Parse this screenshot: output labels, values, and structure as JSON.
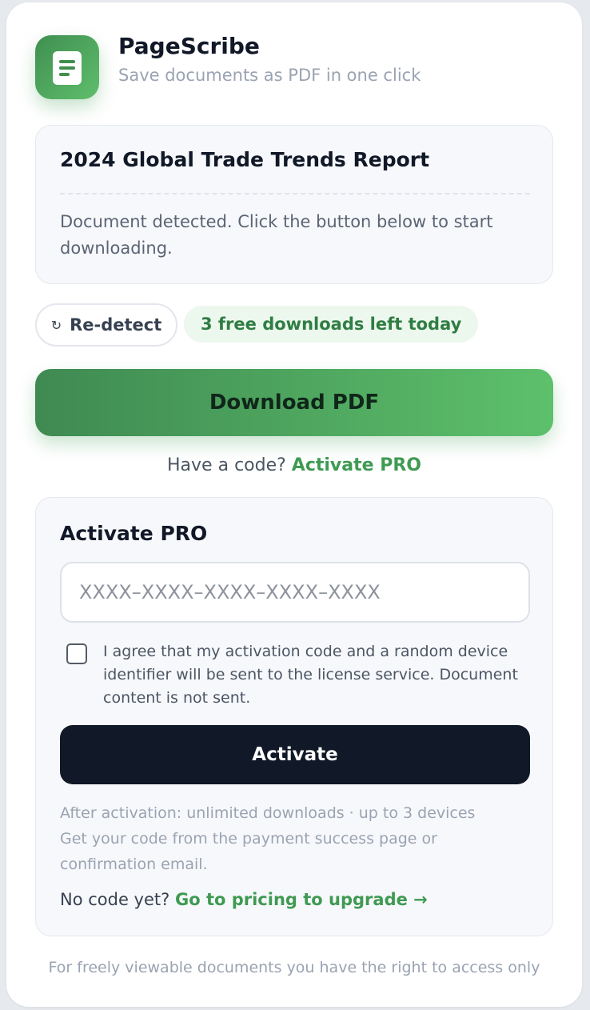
{
  "app": {
    "name": "PageScribe",
    "tagline": "Save documents as PDF in one click",
    "logo_icon": "document-icon"
  },
  "document": {
    "title": "2024 Global Trade Trends Report",
    "status": "Document detected. Click the button below to start downloading."
  },
  "actions": {
    "redetect_icon": "↻",
    "redetect_label": "Re-detect",
    "free_downloads": "3 free downloads left today",
    "download_label": "Download PDF"
  },
  "code_prompt": {
    "text": "Have a code?",
    "link": "Activate PRO"
  },
  "activation": {
    "title": "Activate PRO",
    "placeholder": "XXXX–XXXX–XXXX–XXXX–XXXX",
    "value": "",
    "consent_checked": false,
    "consent_text": "I agree that my activation code and a random device identifier will be sent to the license service. Document content is not sent.",
    "button_label": "Activate",
    "benefits_line1": "After activation: unlimited downloads · up to 3 devices",
    "benefits_line2": "Get your code from the payment success page or",
    "benefits_line3": "confirmation email.",
    "no_code_text": "No code yet?",
    "pricing_link": "Go to pricing to upgrade →"
  },
  "footer": {
    "note": "For freely viewable documents you have the right to access only"
  },
  "colors": {
    "accent_green": "#3f9a52",
    "dark_button": "#111827",
    "badge_bg": "#ecf7ee"
  }
}
